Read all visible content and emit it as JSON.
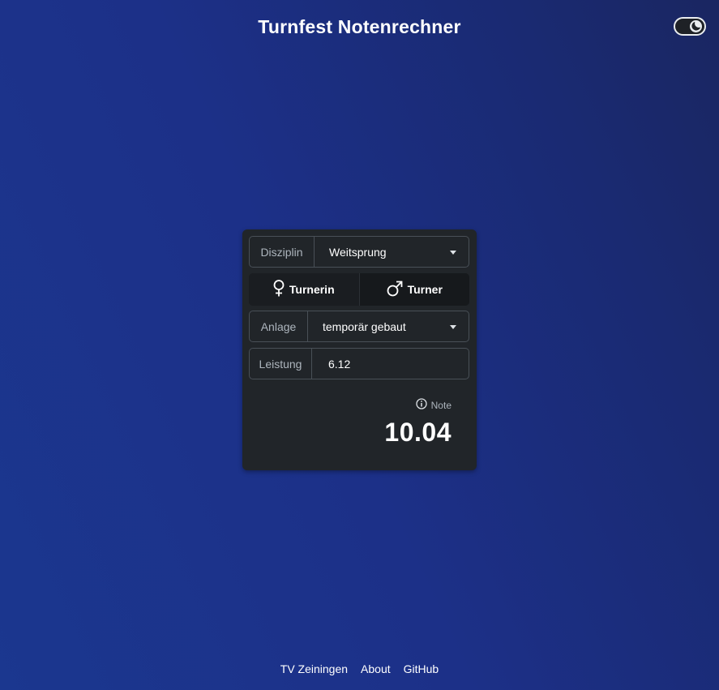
{
  "header": {
    "title": "Turnfest Notenrechner",
    "theme_toggle_icon": "moon-icon"
  },
  "form": {
    "discipline": {
      "label": "Disziplin",
      "value": "Weitsprung"
    },
    "gender": {
      "female": {
        "label": "Turnerin",
        "icon": "female-icon"
      },
      "male": {
        "label": "Turner",
        "icon": "male-icon"
      }
    },
    "facility": {
      "label": "Anlage",
      "value": "temporär gebaut"
    },
    "performance": {
      "label": "Leistung",
      "value": "6.12"
    }
  },
  "result": {
    "label": "Note",
    "value": "10.04",
    "icon": "info-icon"
  },
  "footer": {
    "links": [
      "TV Zeiningen",
      "About",
      "GitHub"
    ]
  },
  "colors": {
    "background": "#1c3088",
    "card": "#212529",
    "border": "#495057",
    "muted_text": "#adb5bd"
  }
}
